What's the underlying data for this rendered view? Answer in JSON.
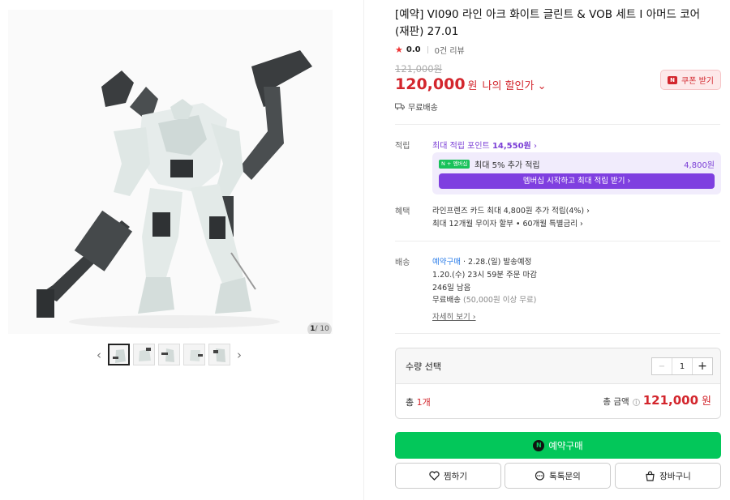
{
  "gallery": {
    "pager_current": "1",
    "pager_total": "/ 10",
    "prev_icon": "chevron-left-icon",
    "next_icon": "chevron-right-icon"
  },
  "product": {
    "title": "[예약] VI090 라인 아크 화이트 글린트 & VOB 세트 I 아머드 코어 (재판) 27.01",
    "rating": "0.0",
    "reviews": "0건 리뷰",
    "original_price": "121,000원",
    "price": "120,000",
    "price_unit": "원",
    "my_discount": "나의 할인가 ⌄",
    "coupon_label": "쿠폰 받기",
    "shipping": "무료배송"
  },
  "points": {
    "label": "적립",
    "max_points": "최대 적립 포인트",
    "max_points_value": "14,550원",
    "membership_badge": "N + 멤버십",
    "extra_pct": "최대 5% 추가 적립",
    "extra_amount": "4,800원",
    "membership_button": "멤버십 시작하고 최대 적립 받기 ›"
  },
  "benefits": {
    "label": "혜택",
    "line1": "라인프렌즈 카드 최대 4,800원 추가 적립(4%) ›",
    "line2": "최대 12개월 무이자 할부 • 60개월 특별금리 ›"
  },
  "delivery": {
    "label": "배송",
    "type": "예약구매",
    "ship_date": "· 2.28.(일) 발송예정",
    "deadline": "1.20.(수) 23시 59분 주문 마감",
    "days_left": "246일 남음",
    "free_ship": "무료배송",
    "free_cond": "(50,000원 이상 무료)",
    "detail_link": "자세히 보기 ›"
  },
  "quantity": {
    "title": "수량 선택",
    "minus": "−",
    "value": "1",
    "plus": "+",
    "total_prefix": "총",
    "total_count": "1개",
    "total_label": "총 금액",
    "total_price": "121,000",
    "total_unit": "원"
  },
  "actions": {
    "buy": "예약구매",
    "wish": "찜하기",
    "talk": "톡톡문의",
    "cart": "장바구니"
  },
  "colors": {
    "price_red": "#d3262d",
    "naver_green": "#03c75a",
    "membership_purple": "#7f3fe0"
  }
}
